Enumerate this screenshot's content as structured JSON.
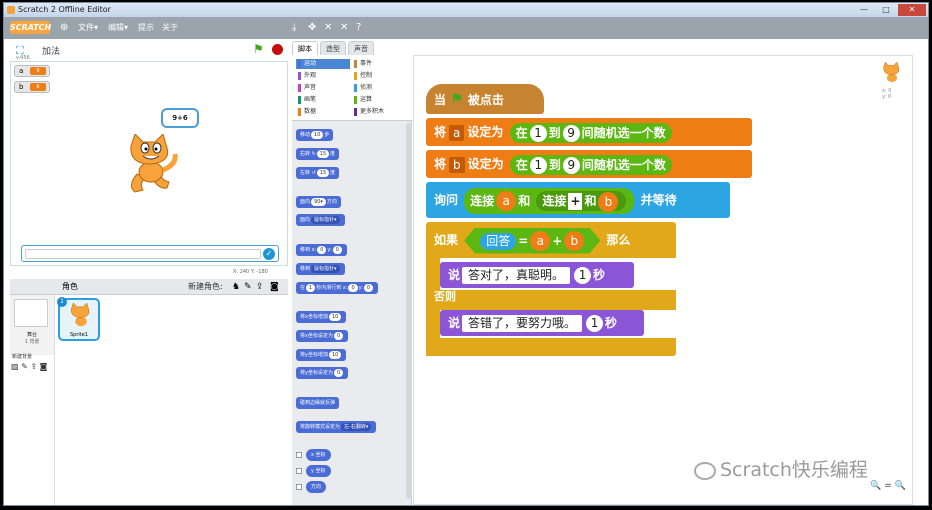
{
  "window": {
    "title": "Scratch 2 Offline Editor",
    "controls": [
      "—",
      "□",
      "✕"
    ]
  },
  "menubar": {
    "logo": "SCRATCH",
    "items": [
      "文件▾",
      "编辑▾",
      "提示",
      "关于"
    ],
    "tools": [
      "⤓",
      "✥",
      "✕",
      "✕",
      "?"
    ]
  },
  "stage": {
    "title": "加法",
    "version": "v.456",
    "vars": [
      {
        "name": "a",
        "value": "9"
      },
      {
        "name": "b",
        "value": "6"
      }
    ],
    "bubble": "9+6",
    "coords": "X: 240   Y: -180"
  },
  "sprites": {
    "header": "角色",
    "new_label": "新建角色:",
    "stage_label": "舞台",
    "stage_sub": "1 背景",
    "new_backdrop": "新建背景",
    "sprite1": {
      "num": "1",
      "name": "Sprite1"
    }
  },
  "tabs": [
    "脚本",
    "造型",
    "声音"
  ],
  "categories": [
    {
      "label": "运动",
      "color": "#4a6cd4"
    },
    {
      "label": "事件",
      "color": "#c88330"
    },
    {
      "label": "外观",
      "color": "#8a55d7"
    },
    {
      "label": "控制",
      "color": "#e1a91a"
    },
    {
      "label": "声音",
      "color": "#bb42c3"
    },
    {
      "label": "侦测",
      "color": "#2ca5e2"
    },
    {
      "label": "画笔",
      "color": "#0e9a6c"
    },
    {
      "label": "运算",
      "color": "#5cb712"
    },
    {
      "label": "数据",
      "color": "#ee7d16"
    },
    {
      "label": "更多积木",
      "color": "#632d99"
    }
  ],
  "palette": {
    "move": "移动",
    "move_val": "10",
    "move_unit": "步",
    "turn_r": "右转 ↻",
    "turn_r_val": "15",
    "turn_unit": "度",
    "turn_l": "左转 ↺",
    "turn_l_val": "15",
    "face": "面向",
    "face_val": "90▾",
    "face_unit": "方向",
    "face_to": "面向",
    "face_to_val": "鼠标指针▾",
    "goto_xy": "移到 x:",
    "gx": "0",
    "gy_lbl": "y:",
    "gy": "0",
    "goto": "移到",
    "goto_val": "鼠标指针▾",
    "glide_pre": "在",
    "glide_t": "1",
    "glide_mid": "秒内滑行到 x:",
    "glide_x": "0",
    "glide_y_lbl": "y:",
    "glide_y": "0",
    "cx": "将x坐标增加",
    "cx_val": "10",
    "sx": "将x坐标设定为",
    "sx_val": "0",
    "cy": "将y坐标增加",
    "cy_val": "10",
    "sy": "将y坐标设定为",
    "sy_val": "0",
    "bounce": "碰到边缘就反弹",
    "rot": "将旋转模式设定为",
    "rot_val": "左-右翻转▾",
    "rep_x": "x 坐标",
    "rep_y": "y 坐标",
    "rep_dir": "方向"
  },
  "script": {
    "hat_when": "当",
    "hat_clicked": "被点击",
    "set": "将",
    "set_to": "设定为",
    "in": "在",
    "to": "到",
    "rand": "间随机选一个数",
    "a": "a",
    "b": "b",
    "one": "1",
    "nine": "9",
    "ask": "询问",
    "join": "连接",
    "and": "和",
    "plus": "+",
    "wait": "并等待",
    "if": "如果",
    "answer": "回答",
    "eq": "=",
    "then": "那么",
    "say": "说",
    "right": "答对了，真聪明。",
    "wrong": "答错了，要努力哦。",
    "sec": "秒",
    "else": "否则"
  },
  "watermark": "Scratch快乐编程",
  "zoom": "🔍 = 🔍",
  "sprite_info": "x: 0\ny: 0"
}
